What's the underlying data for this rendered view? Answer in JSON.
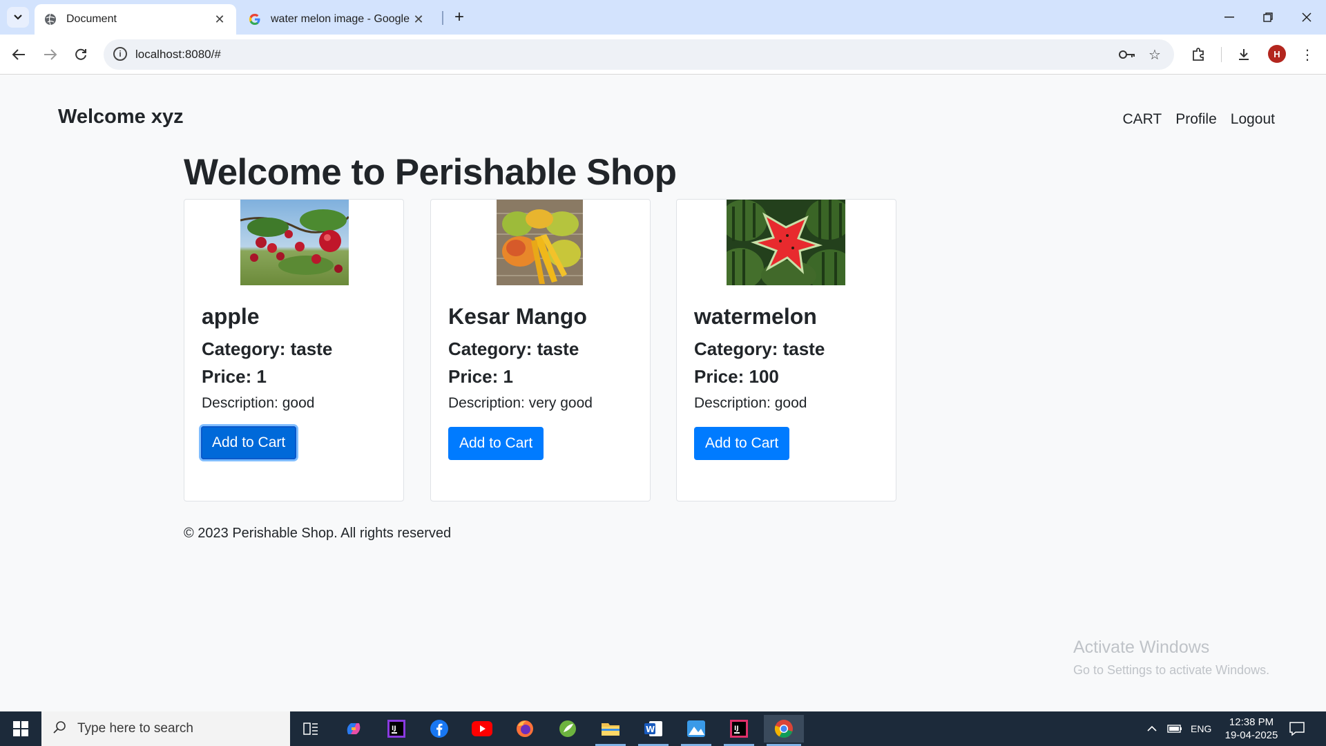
{
  "browser": {
    "tabs": [
      {
        "title": "Document",
        "active": true
      },
      {
        "title": "water melon image - Google Se",
        "active": false
      }
    ],
    "address": "localhost:8080/#",
    "profile_initial": "H"
  },
  "page": {
    "brand": "Welcome xyz",
    "nav": {
      "cart": "CART",
      "profile": "Profile",
      "logout": "Logout"
    },
    "heading": "Welcome to Perishable Shop",
    "products": [
      {
        "name": "apple",
        "category": "Category: taste",
        "price": "Price: 1",
        "description": "Description: good",
        "button": "Add to Cart"
      },
      {
        "name": "Kesar Mango",
        "category": "Category: taste",
        "price": "Price: 1",
        "description": "Description: very good",
        "button": "Add to Cart"
      },
      {
        "name": "watermelon",
        "category": "Category: taste",
        "price": "Price: 100",
        "description": "Description: good",
        "button": "Add to Cart"
      }
    ],
    "footer": "© 2023 Perishable Shop. All rights reserved",
    "watermark_title": "Activate Windows",
    "watermark_sub": "Go to Settings to activate Windows."
  },
  "taskbar": {
    "search_placeholder": "Type here to search",
    "language": "ENG",
    "time": "12:38 PM",
    "date": "19-04-2025"
  },
  "colors": {
    "primary_button": "#007bff",
    "tabstrip": "#d3e3fd",
    "taskbar": "#1c2a3a"
  }
}
